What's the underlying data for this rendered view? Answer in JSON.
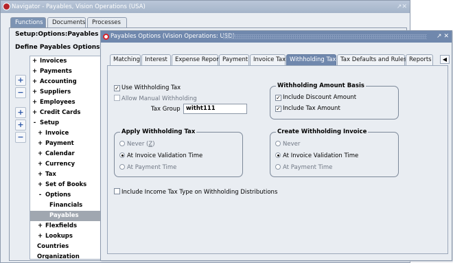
{
  "navigator": {
    "title": "Navigator - Payables, Vision Operations (USA)",
    "window_controls": "↗✕",
    "tabs": [
      {
        "label": "Functions",
        "active": true
      },
      {
        "label": "Documents",
        "active": false
      },
      {
        "label": "Processes",
        "active": false
      }
    ],
    "breadcrumb": "Setup:Options:Payables",
    "heading": "Define Payables Options",
    "side_buttons": [
      "expand-one-icon",
      "collapse-one-icon",
      "expand-branch-icon",
      "expand-all-icon",
      "collapse-all-icon"
    ],
    "side_button_glyphs": [
      "+",
      "−",
      "+",
      "+",
      "−"
    ],
    "tree": [
      {
        "exp": "+",
        "label": "Invoices",
        "indent": 0
      },
      {
        "exp": "+",
        "label": "Payments",
        "indent": 0
      },
      {
        "exp": "+",
        "label": "Accounting",
        "indent": 0
      },
      {
        "exp": "+",
        "label": "Suppliers",
        "indent": 0
      },
      {
        "exp": "+",
        "label": "Employees",
        "indent": 0
      },
      {
        "exp": "+",
        "label": "Credit Cards",
        "indent": 0
      },
      {
        "exp": "-",
        "label": "Setup",
        "indent": 0
      },
      {
        "exp": "+",
        "label": "Invoice",
        "indent": 1
      },
      {
        "exp": "+",
        "label": "Payment",
        "indent": 1
      },
      {
        "exp": "+",
        "label": "Calendar",
        "indent": 1
      },
      {
        "exp": "+",
        "label": "Currency",
        "indent": 1
      },
      {
        "exp": "+",
        "label": "Tax",
        "indent": 1
      },
      {
        "exp": "+",
        "label": "Set of Books",
        "indent": 1
      },
      {
        "exp": "-",
        "label": "Options",
        "indent": 1
      },
      {
        "exp": "",
        "label": "Financials",
        "indent": 2
      },
      {
        "exp": "",
        "label": "Payables",
        "indent": 2,
        "selected": true
      },
      {
        "exp": "+",
        "label": "Flexfields",
        "indent": 1
      },
      {
        "exp": "+",
        "label": "Lookups",
        "indent": 1
      },
      {
        "exp": "",
        "label": "Countries",
        "indent": 1
      },
      {
        "exp": "",
        "label": "Organization",
        "indent": 1
      }
    ]
  },
  "options_window": {
    "title": "Payables Options (Vision Operations: USD)",
    "window_controls": "↗ ✕",
    "tabs": [
      {
        "label": "Matching"
      },
      {
        "label": "Interest"
      },
      {
        "label": "Expense Report"
      },
      {
        "label": "Payment"
      },
      {
        "label": "Invoice Tax"
      },
      {
        "label": "Withholding Tax",
        "active": true
      },
      {
        "label": "Tax Defaults and Rules"
      },
      {
        "label": "Reports"
      }
    ],
    "tab_scroll": "◀",
    "use_withholding_tax": {
      "label": "Use Withholding Tax",
      "checked": true
    },
    "allow_manual_withholding": {
      "label": "Allow Manual Withholding",
      "checked": false
    },
    "tax_group": {
      "label": "Tax Group",
      "value": "witht111"
    },
    "withholding_amount_basis": {
      "title": "Withholding Amount Basis",
      "include_discount": {
        "label": "Include Discount Amount",
        "checked": true
      },
      "include_tax": {
        "label": "Include Tax Amount",
        "checked": true
      }
    },
    "apply_withholding_tax": {
      "title": "Apply Withholding Tax",
      "never_prefix": "Never (",
      "never_key": "Z",
      "never_suffix": ")",
      "options": [
        "At Invoice Validation Time",
        "At Payment Time"
      ],
      "selected": "At Invoice Validation Time"
    },
    "create_withholding_invoice": {
      "title": "Create Withholding Invoice",
      "options": [
        "Never",
        "At Invoice Validation Time",
        "At Payment Time"
      ],
      "selected": "At Invoice Validation Time"
    },
    "include_income_tax_type": {
      "label": "Include Income Tax Type on Withholding Distributions",
      "checked": false
    }
  }
}
